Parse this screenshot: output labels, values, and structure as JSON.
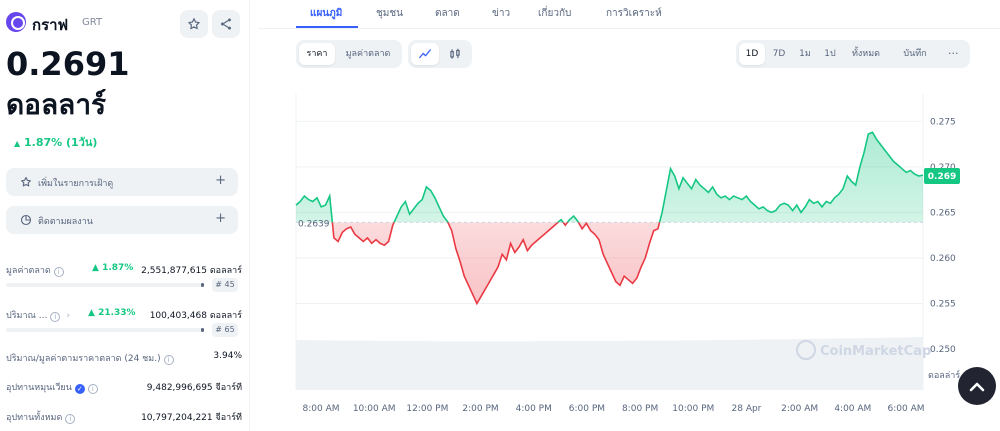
{
  "coin": {
    "name": "กราฟ",
    "symbol": "GRT",
    "price": "0.2691",
    "price_unit": "ดอลลาร์",
    "change": "1.87% (1วัน)"
  },
  "actions": {
    "watchlist": "เพิ่มในรายการเฝ้าดู",
    "portfolio": "ติดตามผลงาน"
  },
  "stats": {
    "market_cap": {
      "label": "มูลค่าตลาด",
      "pct": "1.87%",
      "value": "2,551,877,615 ดอลลาร์",
      "rank": "# 45"
    },
    "volume": {
      "label": "ปริมาณ ...",
      "pct": "21.33%",
      "value": "100,403,468 ดอลลาร์",
      "rank": "# 65"
    },
    "vol_mcap": {
      "label": "ปริมาณ/มูลค่าตามราคาตลาด (24 ชม.)",
      "value": "3.94%"
    },
    "circ_supply": {
      "label": "อุปทานหมุนเวียน",
      "value": "9,482,996,695 จีอาร์ที"
    },
    "total_supply": {
      "label": "อุปทานทั้งหมด",
      "value": "10,797,204,221 จีอาร์ที"
    }
  },
  "tabs": [
    "แผนภูมิ",
    "ชุมชน",
    "ตลาด",
    "ข่าว",
    "เกี่ยวกับ",
    "การวิเคราะห์"
  ],
  "toggles": {
    "price": "ราคา",
    "market_cap": "มูลค่าตลาด"
  },
  "ranges": [
    "1D",
    "7D",
    "1ม",
    "1ป",
    "ทั้งหมด",
    "บันทึก"
  ],
  "more_label": "···",
  "colors": {
    "up": "#16c784",
    "down": "#ea3943",
    "accent": "#3861fb"
  },
  "chart_data": {
    "type": "line",
    "baseline": 0.2639,
    "baseline_label": "0.2639",
    "current": 0.269,
    "current_label": "0.269",
    "ylim": [
      0.2455,
      0.278
    ],
    "y_ticks": [
      0.275,
      0.27,
      0.265,
      0.26,
      0.255,
      0.25
    ],
    "y_tick_labels": [
      "0.275",
      "0.270",
      "0.265",
      "0.260",
      "0.255",
      "0.250"
    ],
    "y_extra_label": "ดอลล่าร์",
    "x_ticks": [
      "8:00 AM",
      "10:00 AM",
      "12:00 PM",
      "2:00 PM",
      "4:00 PM",
      "6:00 PM",
      "8:00 PM",
      "10:00 PM",
      "28 Apr",
      "2:00 AM",
      "4:00 AM",
      "6:00 AM"
    ],
    "watermark": "CoinMarketCap",
    "values": [
      0.2658,
      0.2662,
      0.2668,
      0.2664,
      0.2662,
      0.2666,
      0.2656,
      0.2658,
      0.2668,
      0.2622,
      0.2618,
      0.2628,
      0.2632,
      0.2634,
      0.2626,
      0.2622,
      0.2618,
      0.2622,
      0.2616,
      0.262,
      0.2616,
      0.2614,
      0.2618,
      0.2636,
      0.2646,
      0.2656,
      0.2662,
      0.2648,
      0.2654,
      0.266,
      0.2664,
      0.2678,
      0.2674,
      0.2666,
      0.2656,
      0.2646,
      0.264,
      0.263,
      0.261,
      0.2596,
      0.258,
      0.257,
      0.256,
      0.255,
      0.2558,
      0.2566,
      0.2574,
      0.2582,
      0.259,
      0.2604,
      0.2598,
      0.2616,
      0.2606,
      0.2612,
      0.262,
      0.2608,
      0.2614,
      0.2618,
      0.2622,
      0.2626,
      0.263,
      0.2634,
      0.2638,
      0.2642,
      0.2636,
      0.2642,
      0.2646,
      0.264,
      0.2632,
      0.2638,
      0.263,
      0.2626,
      0.262,
      0.2604,
      0.2594,
      0.2584,
      0.2574,
      0.257,
      0.258,
      0.2576,
      0.2572,
      0.2578,
      0.259,
      0.26,
      0.2616,
      0.263,
      0.2632,
      0.265,
      0.2674,
      0.2698,
      0.269,
      0.2676,
      0.2688,
      0.2682,
      0.2676,
      0.2686,
      0.268,
      0.2676,
      0.2672,
      0.2678,
      0.267,
      0.2666,
      0.2668,
      0.2664,
      0.2668,
      0.2666,
      0.2664,
      0.2668,
      0.2662,
      0.2658,
      0.2654,
      0.2656,
      0.2652,
      0.265,
      0.2652,
      0.2658,
      0.266,
      0.2658,
      0.2652,
      0.2658,
      0.265,
      0.2656,
      0.2664,
      0.266,
      0.2662,
      0.2656,
      0.2662,
      0.266,
      0.2666,
      0.267,
      0.2676,
      0.269,
      0.2684,
      0.268,
      0.27,
      0.2716,
      0.2736,
      0.2738,
      0.273,
      0.2724,
      0.2718,
      0.2712,
      0.2706,
      0.2702,
      0.2698,
      0.2694,
      0.2696,
      0.2692,
      0.269,
      0.2691
    ]
  }
}
